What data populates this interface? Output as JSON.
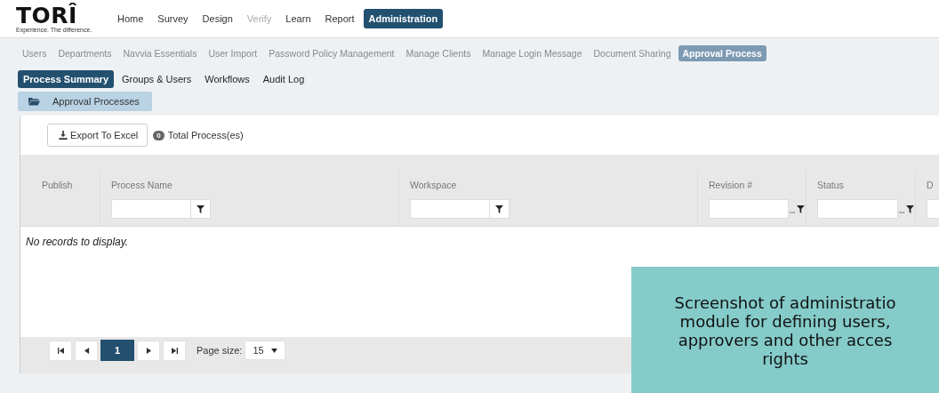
{
  "logo": {
    "name": "TORÎ",
    "tagline": "Experience. The difference."
  },
  "main_nav": [
    {
      "label": "Home",
      "selected": false,
      "disabled": false
    },
    {
      "label": "Survey",
      "selected": false,
      "disabled": false
    },
    {
      "label": "Design",
      "selected": false,
      "disabled": false
    },
    {
      "label": "Verify",
      "selected": false,
      "disabled": true
    },
    {
      "label": "Learn",
      "selected": false,
      "disabled": false
    },
    {
      "label": "Report",
      "selected": false,
      "disabled": false
    },
    {
      "label": "Administration",
      "selected": true,
      "disabled": false
    }
  ],
  "admin_nav": [
    {
      "label": "Users",
      "selected": false
    },
    {
      "label": "Departments",
      "selected": false
    },
    {
      "label": "Navvia Essentials",
      "selected": false
    },
    {
      "label": "User Import",
      "selected": false
    },
    {
      "label": "Password Policy Management",
      "selected": false
    },
    {
      "label": "Manage Clients",
      "selected": false
    },
    {
      "label": "Manage Login Message",
      "selected": false
    },
    {
      "label": "Document Sharing",
      "selected": false
    },
    {
      "label": "Approval Process",
      "selected": true
    }
  ],
  "section_tabs": [
    {
      "label": "Process Summary",
      "selected": true
    },
    {
      "label": "Groups & Users",
      "selected": false
    },
    {
      "label": "Workflows",
      "selected": false
    },
    {
      "label": "Audit Log",
      "selected": false
    }
  ],
  "panel_tab": {
    "label": "Approval Processes"
  },
  "toolbar": {
    "export_button": "Export To Excel",
    "count": "0",
    "count_label": "Total Process(es)"
  },
  "table": {
    "columns": [
      {
        "label": "Publish",
        "kind": "plain"
      },
      {
        "label": "Process Name",
        "kind": "text"
      },
      {
        "label": "Workspace",
        "kind": "text"
      },
      {
        "label": "Revision #",
        "kind": "menu"
      },
      {
        "label": "Status",
        "kind": "menu"
      },
      {
        "label": "D",
        "kind": "field"
      }
    ],
    "empty_message": "No records to display."
  },
  "pager": {
    "pages": [
      {
        "label": "1",
        "selected": true
      }
    ],
    "page_size_label": "Page size:",
    "page_size": "15"
  },
  "caption": {
    "lines": [
      "Screenshot of administratio",
      "module for defining users,",
      "approvers and other acces",
      "rights"
    ]
  }
}
